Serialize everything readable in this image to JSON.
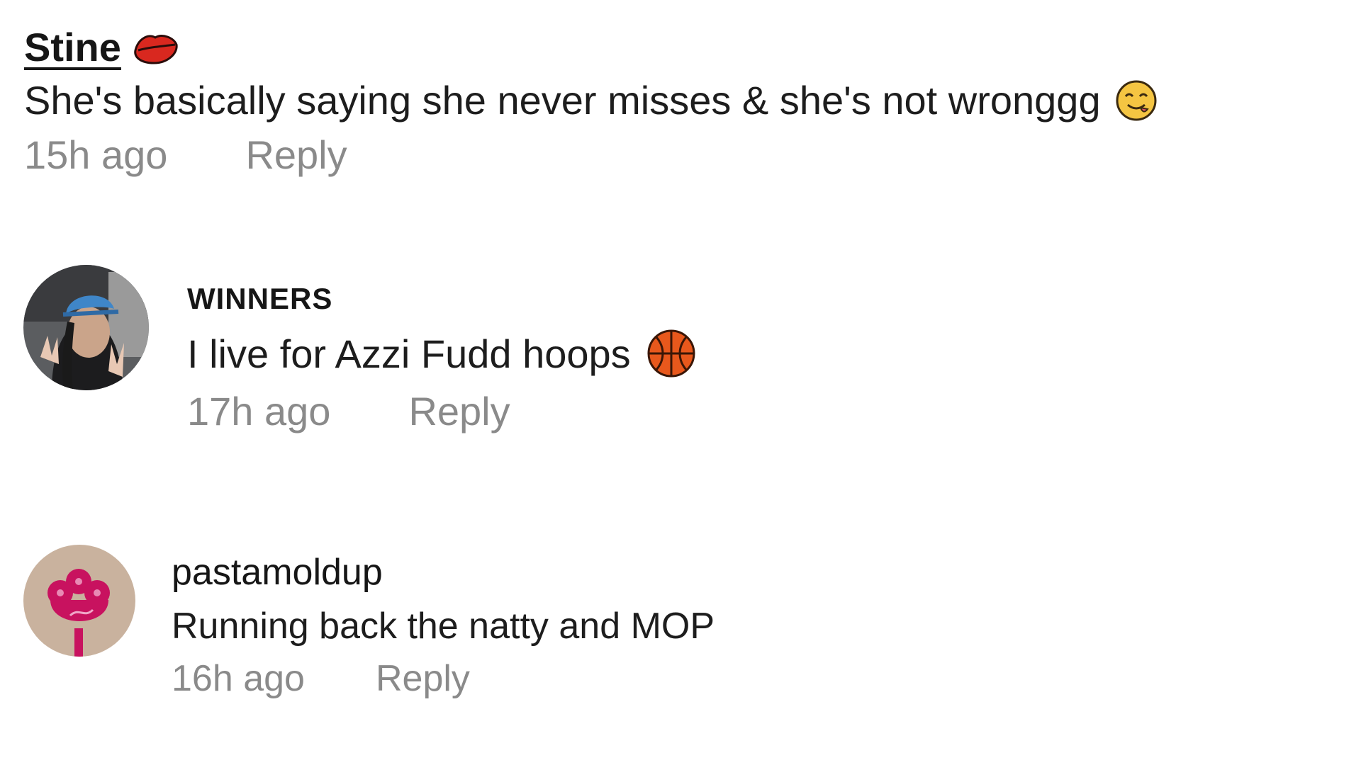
{
  "comments": [
    {
      "username": "Stine",
      "username_icon": "lips-icon",
      "text": "She's basically saying she never misses & she's not wronggg",
      "text_icon": "face-savoring-food-icon",
      "time": "15h ago",
      "reply": "Reply"
    },
    {
      "username": "WINNERS",
      "avatar": "user-photo-avatar",
      "text": "I live for Azzi Fudd hoops",
      "text_icon": "basketball-icon",
      "time": "17h ago",
      "reply": "Reply"
    },
    {
      "username": "pastamoldup",
      "avatar": "flower-avatar",
      "text": "Running back the natty and MOP",
      "time": "16h ago",
      "reply": "Reply"
    }
  ],
  "colors": {
    "meta_text": "#8a8a8a",
    "lips": "#d9281f",
    "basketball": "#e8581c",
    "flower_avatar_bg": "#c9b29e",
    "flower": "#c8125f"
  }
}
